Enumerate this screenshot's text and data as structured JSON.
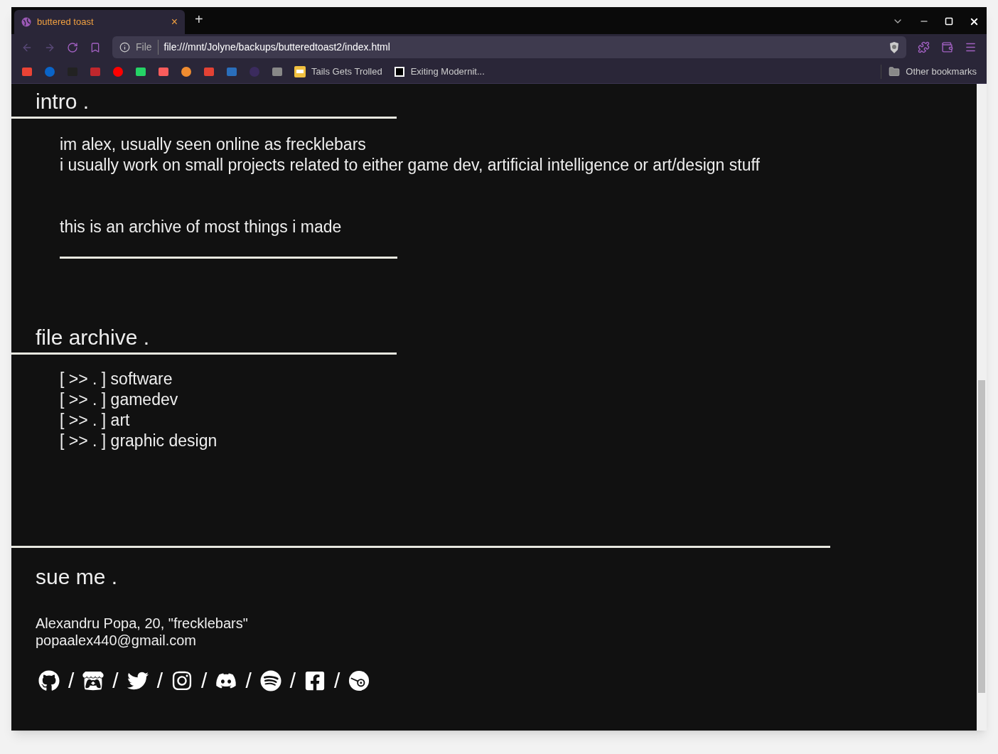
{
  "browser": {
    "tab": {
      "title": "buttered toast",
      "close": "×"
    },
    "new_tab": "+",
    "address": {
      "scheme": "File",
      "url": "file:///mnt/Jolyne/backups/butteredtoast2/index.html"
    },
    "bookmarks": [
      {
        "label": "Tails Gets Trolled"
      },
      {
        "label": "Exiting Modernit..."
      }
    ],
    "other_bookmarks": "Other bookmarks"
  },
  "intro": {
    "heading": "intro .",
    "lines": [
      "im alex, usually seen online as frecklebars",
      "i usually work on small projects related to either game dev, artificial intelligence or art/design stuff"
    ],
    "note": "this is an archive of most things i made"
  },
  "archive": {
    "heading": "file archive .",
    "items": [
      {
        "prefix": "[ >> . ]",
        "label": "software"
      },
      {
        "prefix": "[ >> . ]",
        "label": "gamedev"
      },
      {
        "prefix": "[ >> . ]",
        "label": "art"
      },
      {
        "prefix": "[ >> . ]",
        "label": "graphic design"
      }
    ]
  },
  "footer": {
    "heading": "sue me .",
    "lines": [
      "Alexandru Popa, 20, \"frecklebars\"",
      "popaalex440@gmail.com"
    ],
    "socials": [
      {
        "kind": "github",
        "separator": "/"
      },
      {
        "kind": "itch",
        "separator": "/"
      },
      {
        "kind": "twitter",
        "separator": "/"
      },
      {
        "kind": "instagram",
        "separator": "/"
      },
      {
        "kind": "discord",
        "separator": "/"
      },
      {
        "kind": "spotify",
        "separator": "/"
      },
      {
        "kind": "facebook",
        "separator": "/"
      },
      {
        "kind": "disc"
      }
    ]
  }
}
